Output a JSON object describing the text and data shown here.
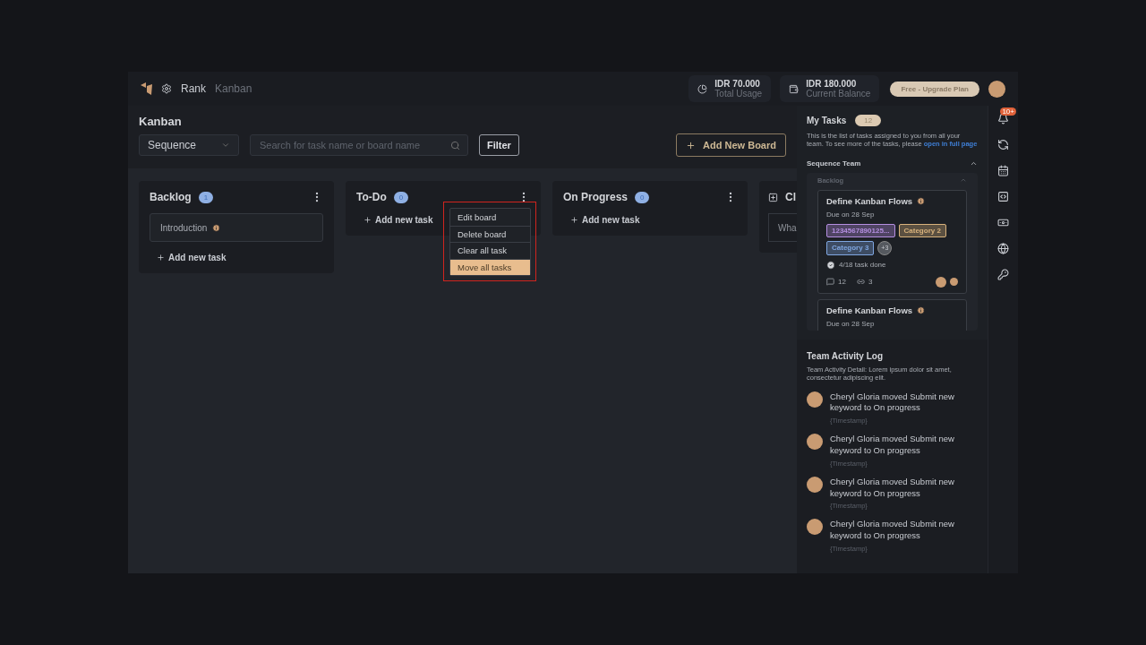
{
  "header": {
    "breadcrumb": [
      {
        "label": "Rank",
        "selected": true
      },
      {
        "label": "Kanban",
        "selected": false
      }
    ],
    "stats": [
      {
        "kind": "usage",
        "value": "IDR 70.000",
        "label": "Total Usage"
      },
      {
        "kind": "balance",
        "value": "IDR 180.000",
        "label": "Current Balance"
      }
    ],
    "plan_button": "Free - Upgrade Plan"
  },
  "toolbar": {
    "title": "Kanban",
    "select": "Sequence",
    "search": {
      "placeholder": "Search for task name or board name"
    },
    "filter": "Filter",
    "add_board": "Add New Board"
  },
  "boards": [
    {
      "kind": "column",
      "title": "Backlog",
      "count": "1",
      "tasks": [
        "Introduction"
      ],
      "add_task": "Add new task",
      "menu_open": false
    },
    {
      "kind": "column",
      "title": "To-Do",
      "count": "0",
      "add_task": "Add new task",
      "menu_open": true
    },
    {
      "kind": "column",
      "title": "On Progress",
      "count": "0",
      "add_task": "Add new task",
      "menu_open": false
    },
    {
      "kind": "new",
      "title": "Cl",
      "placeholder": "Wha"
    }
  ],
  "board_menu": [
    {
      "label": "Edit board",
      "selected": false
    },
    {
      "label": "Delete board",
      "selected": false
    },
    {
      "label": "Clear all task",
      "selected": false
    },
    {
      "label": "Move all tasks",
      "selected": true
    }
  ],
  "my_tasks": {
    "title": "My Tasks",
    "count": "12",
    "description": "This is the list of tasks assigned to you from all your team. To see more of the tasks, please",
    "link": "open in full page",
    "team": {
      "name": "Sequence Team",
      "expanded": true,
      "group": {
        "name": "Backlog",
        "expanded": true,
        "cards": [
          {
            "title": "Define Kanban Flows",
            "due": "Due on 28 Sep",
            "tags": [
              {
                "label": "1234567890125...",
                "color": "#b48ee0"
              },
              {
                "label": "Category 2",
                "color": "#d8b27c"
              },
              {
                "label": "Category 3",
                "color": "#7fa6e0"
              }
            ],
            "more": "+3",
            "progress": "4/18 task done",
            "comments": "12",
            "links": "3"
          },
          {
            "title": "Define Kanban Flows",
            "due": "Due on 28 Sep"
          }
        ]
      }
    }
  },
  "activity": {
    "title": "Team Activity Log",
    "detail": "Team Activity Detail: Lorem ipsum dolor sit amet, consectetur adipiscing elit.",
    "entries": [
      {
        "text": "Cheryl Gloria moved Submit new keyword to On progress",
        "time": "{Timestamp}"
      },
      {
        "text": "Cheryl Gloria moved Submit new keyword to On progress",
        "time": "{Timestamp}"
      },
      {
        "text": "Cheryl Gloria moved Submit new keyword to On progress",
        "time": "{Timestamp}"
      },
      {
        "text": "Cheryl Gloria moved Submit new keyword to On progress",
        "time": "{Timestamp}"
      }
    ]
  },
  "rail": [
    {
      "kind": "bell",
      "badge": "10+"
    },
    {
      "kind": "sync"
    },
    {
      "kind": "calendar"
    },
    {
      "kind": "code"
    },
    {
      "kind": "money"
    },
    {
      "kind": "globe"
    },
    {
      "kind": "key"
    }
  ]
}
